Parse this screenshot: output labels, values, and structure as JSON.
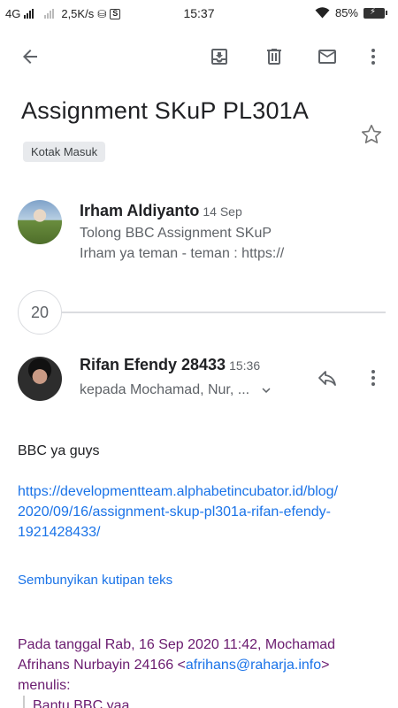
{
  "status_bar": {
    "network": "4G",
    "speed": "2,5K/s",
    "time": "15:37",
    "battery": "85%"
  },
  "toolbar": {
    "back": "back-arrow-icon",
    "archive": "archive-icon",
    "delete": "delete-icon",
    "mark_unread": "mail-icon",
    "more": "more-vert-icon"
  },
  "thread": {
    "subject": "Assignment SKuP PL301A",
    "label": "Kotak Masuk",
    "collapsed_count": "20"
  },
  "messages": [
    {
      "sender": "Irham Aldiyanto",
      "date": "14 Sep",
      "subject_line": "Tolong BBC Assignment SKuP",
      "snippet": "Irham ya teman - teman : https://"
    },
    {
      "sender": "Rifan Efendy 28433",
      "time": "15:36",
      "recipients": "kepada Mochamad, Nur, ..."
    }
  ],
  "body": {
    "greeting": "BBC ya guys",
    "link_line1": "https://developmentteam.alphabetincubator.id/blog/",
    "link_line2": "2020/09/16/assignment-skup-pl301a-rifan-efendy-",
    "link_line3": "1921428433/",
    "hide_quote": "Sembunyikan kutipan teks",
    "quote_line1": "Pada tanggal Rab, 16 Sep 2020 11:42, Mochamad",
    "quote_line2_prefix": "Afrihans Nurbayin 24166 <",
    "quote_email": "afrihans@raharja.info",
    "quote_line2_suffix": ">",
    "quote_line3": "menulis:",
    "quoted_text": "Bantu BBC yaa"
  },
  "colors": {
    "link": "#1a73e8",
    "quote": "#6a1b6f",
    "chip_bg": "#e8eaed"
  }
}
